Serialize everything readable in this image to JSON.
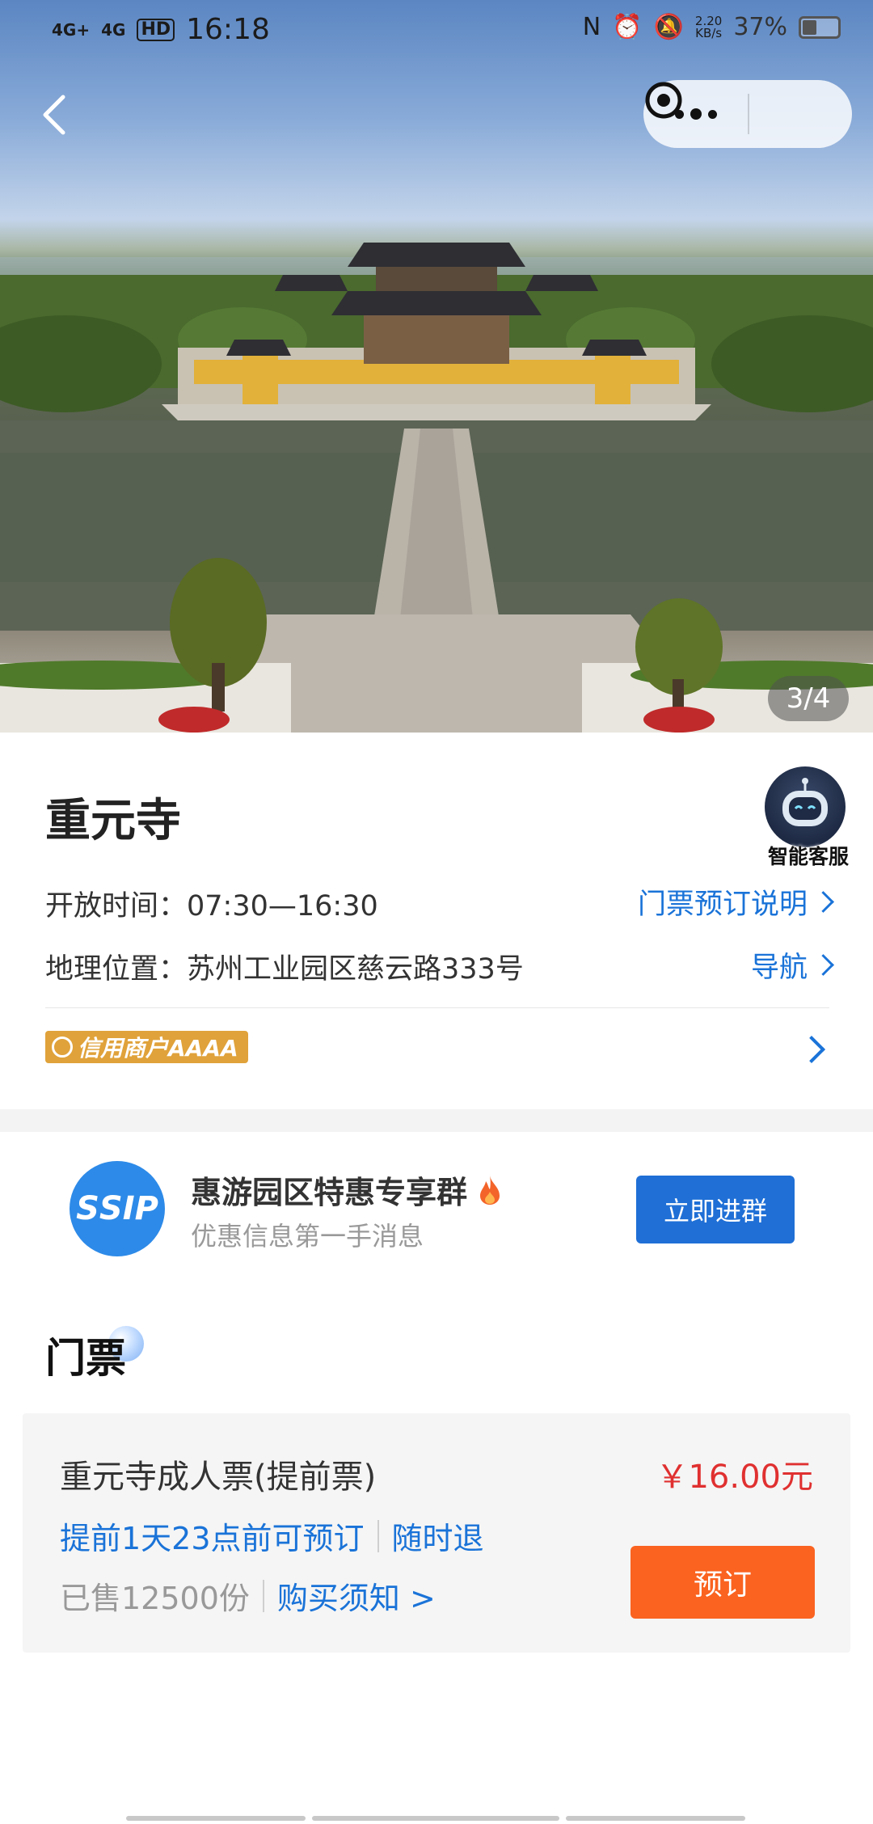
{
  "status_bar": {
    "signal1": "4G+",
    "signal2": "4G",
    "hd": "HD",
    "time": "16:18",
    "net_speed_value": "2.20",
    "net_speed_unit": "KB/s",
    "battery_percent": "37%",
    "battery_level": 0.37
  },
  "gallery": {
    "counter": "3/4"
  },
  "attraction": {
    "name": "重元寺",
    "hours_label": "开放时间：",
    "hours_value": "07:30—16:30",
    "ticket_notes_link": "门票预订说明",
    "location_label": "地理位置：",
    "location_value": "苏州工业园区慈云路333号",
    "navigate_link": "导航",
    "credit_badge": "信用商户AAAA"
  },
  "assistant": {
    "label": "智能客服"
  },
  "group": {
    "logo_text": "SIP",
    "title": "惠游园区特惠专享群",
    "subtitle": "优惠信息第一手消息",
    "join_button": "立即进群"
  },
  "tickets": {
    "section_title": "门票",
    "items": [
      {
        "name": "重元寺成人票(提前票)",
        "price": "￥16.00元",
        "tag1": "提前1天23点前可预订",
        "tag2": "随时退",
        "sold": "已售12500份",
        "purchase_notes": "购买须知 >",
        "book_button": "预订"
      }
    ]
  },
  "colors": {
    "accent_blue": "#1a73d8",
    "price_red": "#e03030",
    "book_orange": "#fa6320",
    "badge_gold": "#e0a23a"
  }
}
